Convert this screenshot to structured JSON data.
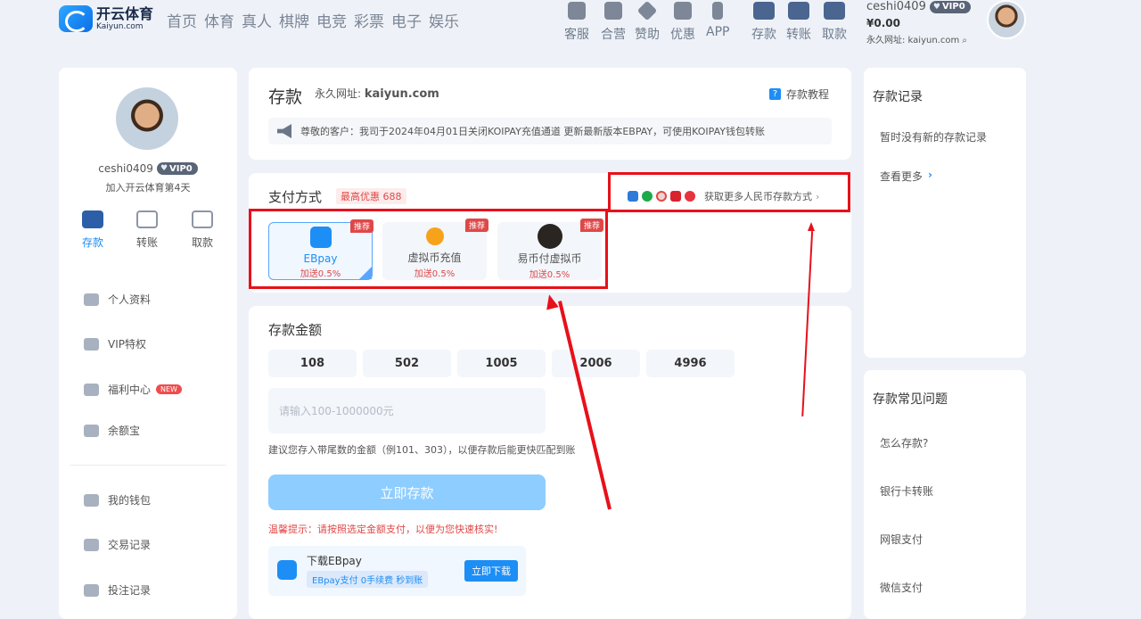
{
  "brand": {
    "logo_cn": "开云体育",
    "logo_en": "Kaiyun.com"
  },
  "main_nav": [
    "首页",
    "体育",
    "真人",
    "棋牌",
    "电竞",
    "彩票",
    "电子",
    "娱乐"
  ],
  "icon_nav": [
    {
      "label": "客服",
      "icon": "customer-service-icon"
    },
    {
      "label": "合营",
      "icon": "partner-icon"
    },
    {
      "label": "赞助",
      "icon": "sponsor-icon"
    },
    {
      "label": "优惠",
      "icon": "gift-icon"
    },
    {
      "label": "APP",
      "icon": "phone-icon"
    },
    {
      "label": "存款",
      "icon": "deposit-icon"
    },
    {
      "label": "转账",
      "icon": "transfer-icon"
    },
    {
      "label": "取款",
      "icon": "withdraw-icon"
    }
  ],
  "user": {
    "name": "ceshi0409",
    "vip": "VIP0",
    "balance": "¥0.00",
    "permanent_url": "永久网址: kaiyun.com",
    "joined": "加入开云体育第4天"
  },
  "quick_actions": [
    "存款",
    "转账",
    "取款"
  ],
  "left_menu": [
    {
      "label": "个人资料",
      "icon": "id-card-icon"
    },
    {
      "label": "VIP特权",
      "icon": "vip-icon"
    },
    {
      "label": "福利中心",
      "icon": "welfare-icon",
      "badge": "NEW"
    },
    {
      "label": "余额宝",
      "icon": "savings-icon"
    },
    {
      "label": "我的钱包",
      "icon": "wallet-icon"
    },
    {
      "label": "交易记录",
      "icon": "transaction-icon"
    },
    {
      "label": "投注记录",
      "icon": "bet-record-icon"
    }
  ],
  "deposit_header": {
    "title": "存款",
    "url_label": "永久网址:",
    "url": "kaiyun.com",
    "tutorial": "存款教程",
    "notice": "尊敬的客户：我司于2024年04月01日关闭KOIPAY充值通道 更新最新版本EBPAY，可使用KOIPAY钱包转账"
  },
  "payment": {
    "title": "支付方式",
    "discount": "最高优惠 688",
    "more": "获取更多人民币存款方式",
    "badge": "推荐",
    "methods": [
      {
        "name": "EBpay",
        "bonus": "加送0.5%",
        "selected": true
      },
      {
        "name": "虚拟币充值",
        "bonus": "加送0.5%",
        "selected": false
      },
      {
        "name": "易币付虚拟币",
        "bonus": "加送0.5%",
        "selected": false
      }
    ]
  },
  "amount": {
    "title": "存款金额",
    "presets": [
      "108",
      "502",
      "1005",
      "2006",
      "4996"
    ],
    "placeholder": "请输入100-1000000元",
    "hint": "建议您存入带尾数的金额（例101、303），以便存款后能更快匹配到账",
    "submit": "立即存款",
    "warning": "温馨提示：请按照选定金额支付，以便为您快速核实!"
  },
  "download": {
    "title": "下载EBpay",
    "tagline": "EBpay支付 0手续费 秒到账",
    "button": "立即下载"
  },
  "records": {
    "title": "存款记录",
    "empty": "暂时没有新的存款记录",
    "more": "查看更多"
  },
  "faq": {
    "title": "存款常见问题",
    "items": [
      "怎么存款?",
      "银行卡转账",
      "网银支付",
      "微信支付"
    ]
  },
  "colors": {
    "accent": "#1d8ef5",
    "highlight": "#e8101a",
    "discount": "#e04848"
  }
}
